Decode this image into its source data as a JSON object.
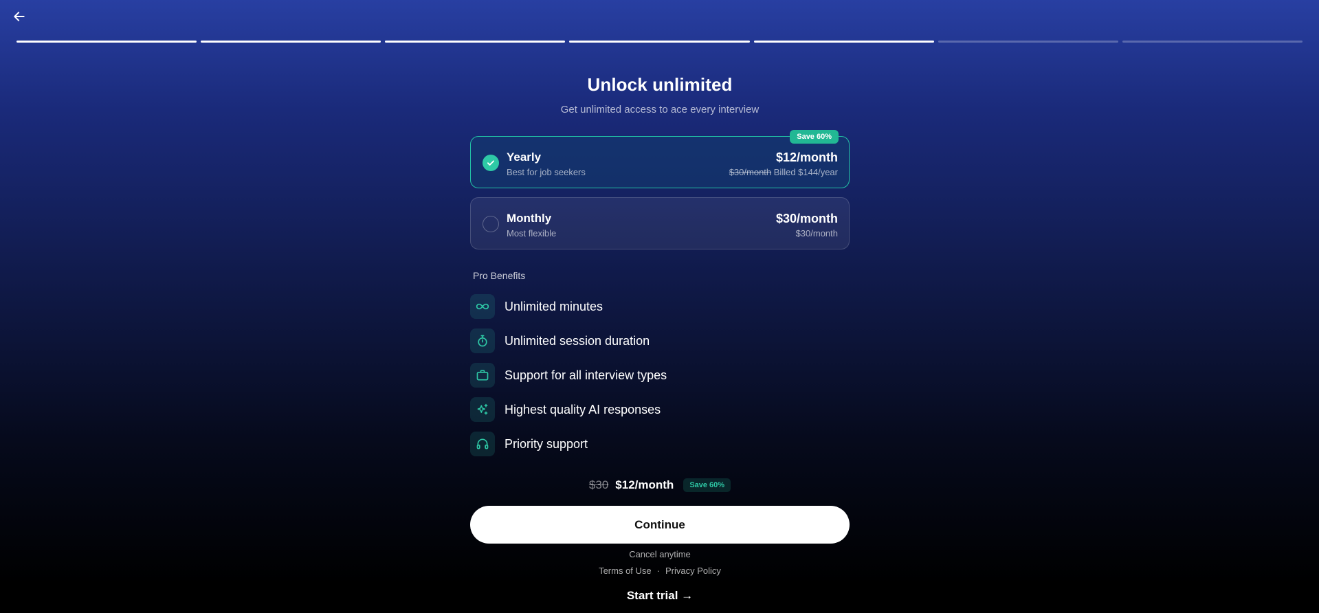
{
  "header": {
    "back_icon": "arrow-left-icon",
    "progress_steps": [
      true,
      true,
      true,
      true,
      true,
      false,
      false
    ]
  },
  "main": {
    "title": "Unlock unlimited",
    "subtitle": "Get unlimited access to ace every interview"
  },
  "plans": {
    "yearly": {
      "name": "Yearly",
      "description": "Best for job seekers",
      "price": "$12/month",
      "original_price": "$30/month",
      "billing": "Billed $144/year",
      "badge": "Save 60%",
      "selected": true
    },
    "monthly": {
      "name": "Monthly",
      "description": "Most flexible",
      "price": "$30/month",
      "billing": "$30/month",
      "selected": false
    }
  },
  "benefits": {
    "title": "Pro Benefits",
    "items": [
      {
        "label": "Unlimited minutes",
        "icon": "infinity-icon"
      },
      {
        "label": "Unlimited session duration",
        "icon": "stopwatch-icon"
      },
      {
        "label": "Support for all interview types",
        "icon": "briefcase-icon"
      },
      {
        "label": "Highest quality AI responses",
        "icon": "sparkles-icon"
      },
      {
        "label": "Priority support",
        "icon": "headset-icon"
      }
    ]
  },
  "summary": {
    "old_price": "$30",
    "new_price": "$12/month",
    "badge": "Save 60%"
  },
  "footer": {
    "continue_label": "Continue",
    "cancel_note": "Cancel anytime",
    "terms_label": "Terms of Use",
    "separator": "·",
    "privacy_label": "Privacy Policy",
    "start_trial_label": "Start trial →"
  },
  "colors": {
    "accent": "#2ec9a6",
    "badge": "#22b894",
    "background_top": "#283fa2",
    "background_bottom": "#000000"
  }
}
